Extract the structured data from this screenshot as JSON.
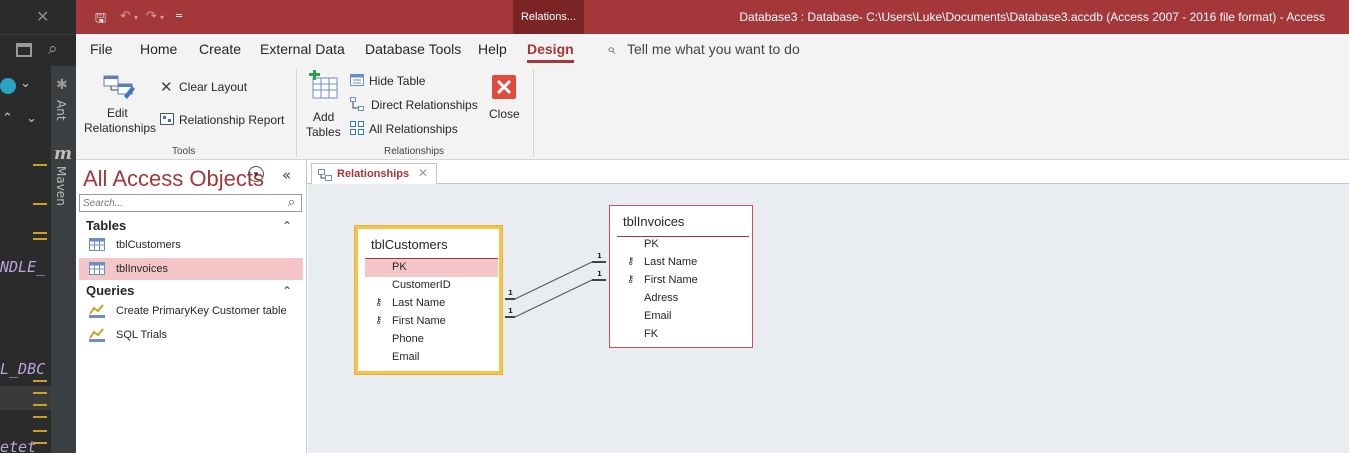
{
  "ide": {
    "close_glyph": "✕",
    "vertical_labels": [
      "Ant",
      "Maven"
    ],
    "maven_glyph": "m",
    "code_fragments": [
      "NDLE_",
      "L_DBC",
      "etet"
    ]
  },
  "titlebar": {
    "context_tab": "Relations...",
    "window_title": "Database3 : Database- C:\\Users\\Luke\\Documents\\Database3.accdb (Access 2007 - 2016 file format)  -  Access",
    "bg_color": "#a4373a"
  },
  "menu": {
    "tabs": [
      "File",
      "Home",
      "Create",
      "External Data",
      "Database Tools",
      "Help",
      "Design"
    ],
    "active_tab": "Design",
    "tell_me": "Tell me what you want to do"
  },
  "ribbon": {
    "tools": {
      "edit_relationships_line1": "Edit",
      "edit_relationships_line2": "Relationships",
      "clear_layout": "Clear Layout",
      "relationship_report": "Relationship Report",
      "group_label": "Tools"
    },
    "relationships": {
      "add_tables_line1": "Add",
      "add_tables_line2": "Tables",
      "hide_table": "Hide Table",
      "direct_relationships": "Direct Relationships",
      "all_relationships": "All Relationships",
      "close": "Close",
      "group_label": "Relationships"
    }
  },
  "nav": {
    "title": "All Access Objects",
    "search_placeholder": "Search...",
    "collapse_glyph": "«",
    "tables_header": "Tables",
    "tables": [
      "tblCustomers",
      "tblInvoices"
    ],
    "selected_table": "tblInvoices",
    "queries_header": "Queries",
    "queries": [
      "Create PrimaryKey Customer table",
      "SQL Trials"
    ]
  },
  "document": {
    "tab_label": "Relationships"
  },
  "diagram": {
    "customers": {
      "title": "tblCustomers",
      "fields": [
        "PK",
        "CustomerID",
        "Last Name",
        "First Name",
        "Phone",
        "Email"
      ],
      "key_fields": [
        "Last Name",
        "First Name"
      ],
      "highlighted_field": "PK"
    },
    "invoices": {
      "title": "tblInvoices",
      "fields": [
        "PK",
        "Last Name",
        "First Name",
        "Adress",
        "Email",
        "FK"
      ],
      "key_fields": [
        "Last Name",
        "First Name"
      ]
    },
    "relationships": [
      {
        "from": "tblCustomers.Last Name",
        "to": "tblInvoices.Last Name",
        "from_cardinality": "1",
        "to_cardinality": "1"
      },
      {
        "from": "tblCustomers.First Name",
        "to": "tblInvoices.First Name",
        "from_cardinality": "1",
        "to_cardinality": "1"
      }
    ]
  }
}
